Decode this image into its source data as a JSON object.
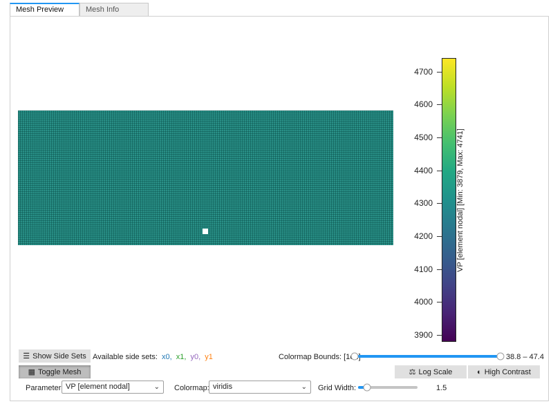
{
  "tabs": [
    {
      "label": "Mesh Preview",
      "active": true
    },
    {
      "label": "Mesh Info",
      "active": false
    }
  ],
  "colorbar": {
    "label": "VP [element nodal] [Min: 3879, Max: 4741]",
    "colormap": "viridis",
    "ticks": [
      "4700",
      "4600",
      "4500",
      "4400",
      "4300",
      "4200",
      "4100",
      "4000",
      "3900"
    ]
  },
  "controls": {
    "show_side_sets": "Show Side Sets",
    "available_side_sets_label": "Available side sets:",
    "side_sets": [
      {
        "name": "x0",
        "color": "#1f77b4"
      },
      {
        "name": "x1",
        "color": "#2ca02c"
      },
      {
        "name": "y0",
        "color": "#9467bd"
      },
      {
        "name": "y1",
        "color": "#ff7f0e"
      }
    ],
    "toggle_mesh": "Toggle Mesh",
    "colormap_bounds_label": "Colormap Bounds: [1e2]",
    "colormap_bounds_value": "38.8 – 47.4",
    "log_scale": "Log Scale",
    "high_contrast": "High Contrast",
    "parameter_label": "Parameter:",
    "parameter_value": "VP [element nodal]",
    "colormap_label": "Colormap:",
    "colormap_value": "viridis",
    "grid_width_label": "Grid Width:",
    "grid_width_value": "1.5"
  },
  "icons": {
    "show_side_sets": "list-icon",
    "toggle_mesh": "grid-icon",
    "log_scale": "scale-icon",
    "high_contrast": "contrast-icon"
  }
}
